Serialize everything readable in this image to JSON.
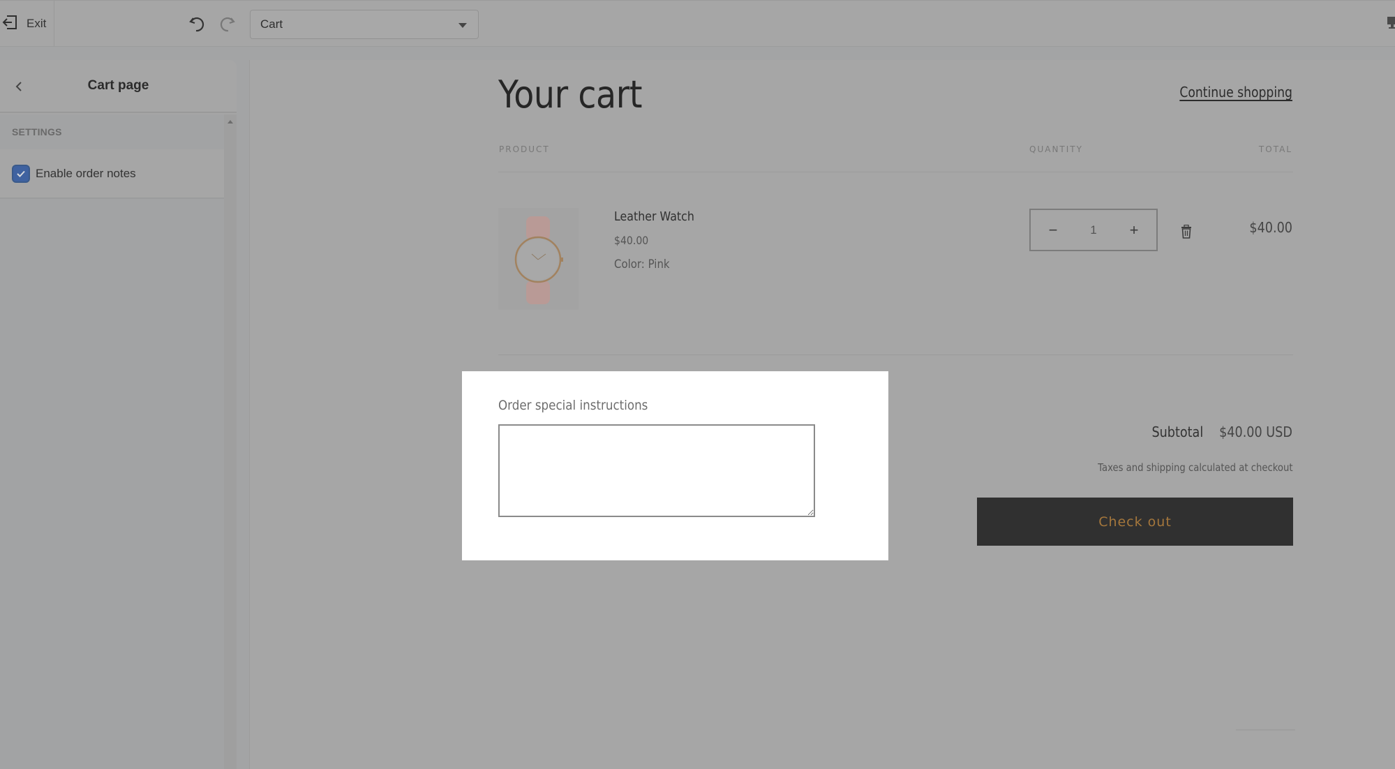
{
  "topbar": {
    "exit_label": "Exit",
    "exit_icon": "exit-arrow-icon",
    "undo_icon": "undo-icon",
    "redo_icon": "redo-icon",
    "template_select": {
      "selected": "Cart"
    },
    "device_icon": "desktop-icon"
  },
  "sidebar": {
    "title": "Cart page",
    "back_icon": "chevron-left-icon",
    "section_title": "SETTINGS",
    "settings": [
      {
        "label": "Enable order notes",
        "checked": true
      }
    ]
  },
  "cart": {
    "title": "Your cart",
    "continue_link": "Continue shopping",
    "columns": {
      "product": "PRODUCT",
      "quantity": "QUANTITY",
      "total": "TOTAL"
    },
    "items": [
      {
        "name": "Leather Watch",
        "price": "$40.00",
        "option": "Color: Pink",
        "quantity": "1",
        "line_total": "$40.00",
        "image": "pink-leather-watch-image"
      }
    ],
    "qty_minus": "−",
    "qty_plus": "+",
    "notes": {
      "label": "Order special instructions",
      "value": ""
    },
    "subtotal_label": "Subtotal",
    "subtotal_value": "$40.00 USD",
    "tax_note": "Taxes and shipping calculated at checkout",
    "checkout_label": "Check out"
  },
  "colors": {
    "overlay": "#a6a6a6",
    "checkbox_accent": "#3f62a0",
    "checkout_bg": "#303030",
    "checkout_text": "#a5773c",
    "highlight_bg": "#ffffff"
  }
}
